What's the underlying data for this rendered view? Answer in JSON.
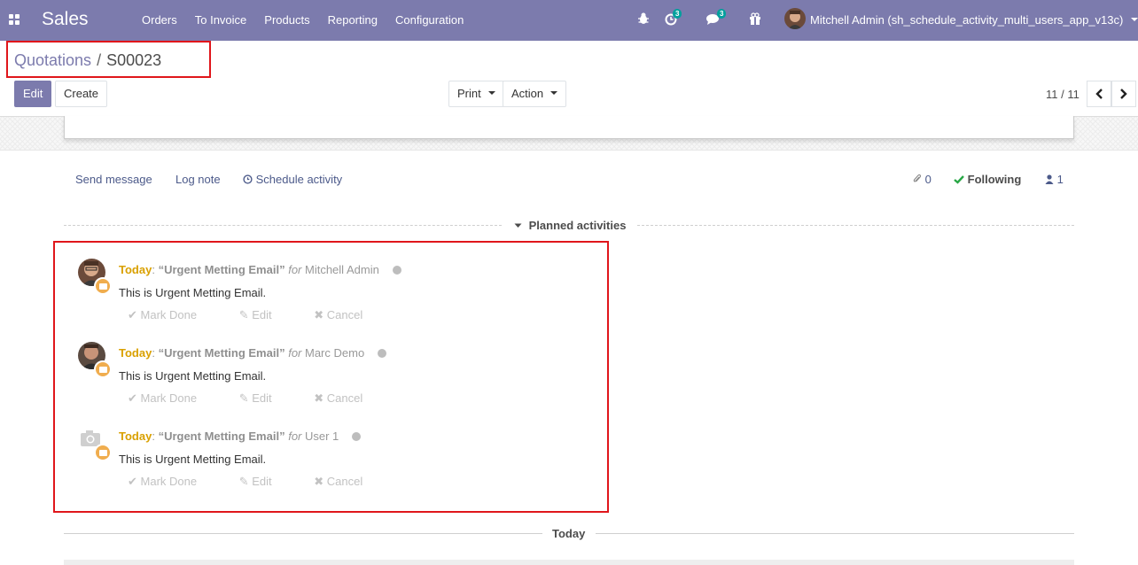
{
  "navbar": {
    "brand": "Sales",
    "menu": [
      "Orders",
      "To Invoice",
      "Products",
      "Reporting",
      "Configuration"
    ],
    "activity_count": "3",
    "message_count": "3",
    "user": "Mitchell Admin (sh_schedule_activity_multi_users_app_v13c)",
    "bg_color": "#7c7bad"
  },
  "breadcrumb": {
    "parent": "Quotations",
    "separator": "/",
    "current": "S00023"
  },
  "toolbar": {
    "edit": "Edit",
    "create": "Create",
    "print": "Print",
    "action": "Action"
  },
  "pager": {
    "value": "11 / 11"
  },
  "chatter": {
    "send_message": "Send message",
    "log_note": "Log note",
    "schedule_activity": "Schedule activity",
    "attachments": "0",
    "following": "Following",
    "followers": "1"
  },
  "planned": {
    "title": "Planned activities",
    "activities": [
      {
        "when": "Today",
        "summary": "“Urgent Metting Email”",
        "for_label": "for",
        "assignee": "Mitchell Admin",
        "note": "This is Urgent Metting Email.",
        "mark_done": "Mark Done",
        "edit": "Edit",
        "cancel": "Cancel",
        "avatar": "photo"
      },
      {
        "when": "Today",
        "summary": "“Urgent Metting Email”",
        "for_label": "for",
        "assignee": "Marc Demo",
        "note": "This is Urgent Metting Email.",
        "mark_done": "Mark Done",
        "edit": "Edit",
        "cancel": "Cancel",
        "avatar": "photo"
      },
      {
        "when": "Today",
        "summary": "“Urgent Metting Email”",
        "for_label": "for",
        "assignee": "User 1",
        "note": "This is Urgent Metting Email.",
        "mark_done": "Mark Done",
        "edit": "Edit",
        "cancel": "Cancel",
        "avatar": "camera-placeholder"
      }
    ]
  },
  "today_separator": "Today",
  "colors": {
    "accent": "#7c7bad",
    "highlight": "#e0161b",
    "today": "#d9a000",
    "activity_type": "#f0ad4e"
  }
}
